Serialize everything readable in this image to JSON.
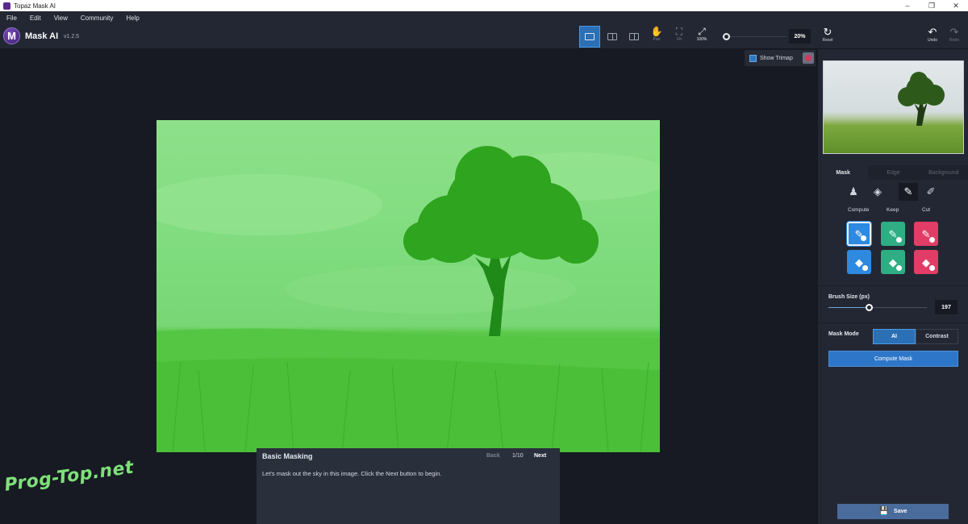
{
  "window": {
    "title": "Topaz Mask AI",
    "controls": [
      "–",
      "❐",
      "✕"
    ]
  },
  "menu": [
    "File",
    "Edit",
    "View",
    "Community",
    "Help"
  ],
  "app": {
    "logo_letter": "M",
    "name": "Mask AI",
    "version": "v1.2.5"
  },
  "toolbar": {
    "pan_label": "Pan",
    "fit_label": "Fit",
    "zoom100_label": "100%",
    "zoom_value": "20%",
    "reset_label": "Reset",
    "undo_label": "Undo",
    "redo_label": "Redo"
  },
  "canvas": {
    "show_trimap_label": "Show Trimap",
    "show_trimap_checked": true,
    "mask_overlay_color": "#5ee05a"
  },
  "tutorial": {
    "title": "Basic Masking",
    "back_label": "Back",
    "counter": "1/10",
    "next_label": "Next",
    "body": "Let's mask out the sky in this image. Click the Next button to begin."
  },
  "panel": {
    "tabs": [
      "Mask",
      "Edge",
      "Background"
    ],
    "active_tab": "Mask",
    "tool_icons": [
      "compute-tool-icon",
      "fill-tool-icon",
      "brush-tool-icon",
      "eyedropper-tool-icon"
    ],
    "columns": [
      "Compute",
      "Keep",
      "Cut"
    ],
    "colors": {
      "compute": "#2d8ae0",
      "keep": "#2fae84",
      "cut": "#e13d66"
    },
    "brush_size_label": "Brush Size (px)",
    "brush_size_value": "197",
    "mask_mode_label": "Mask Mode",
    "mask_mode_options": [
      "AI",
      "Contrast"
    ],
    "mask_mode_selected": "AI",
    "compute_mask_label": "Compute Mask",
    "save_label": "Save"
  },
  "watermark": "Prog-Top.net"
}
